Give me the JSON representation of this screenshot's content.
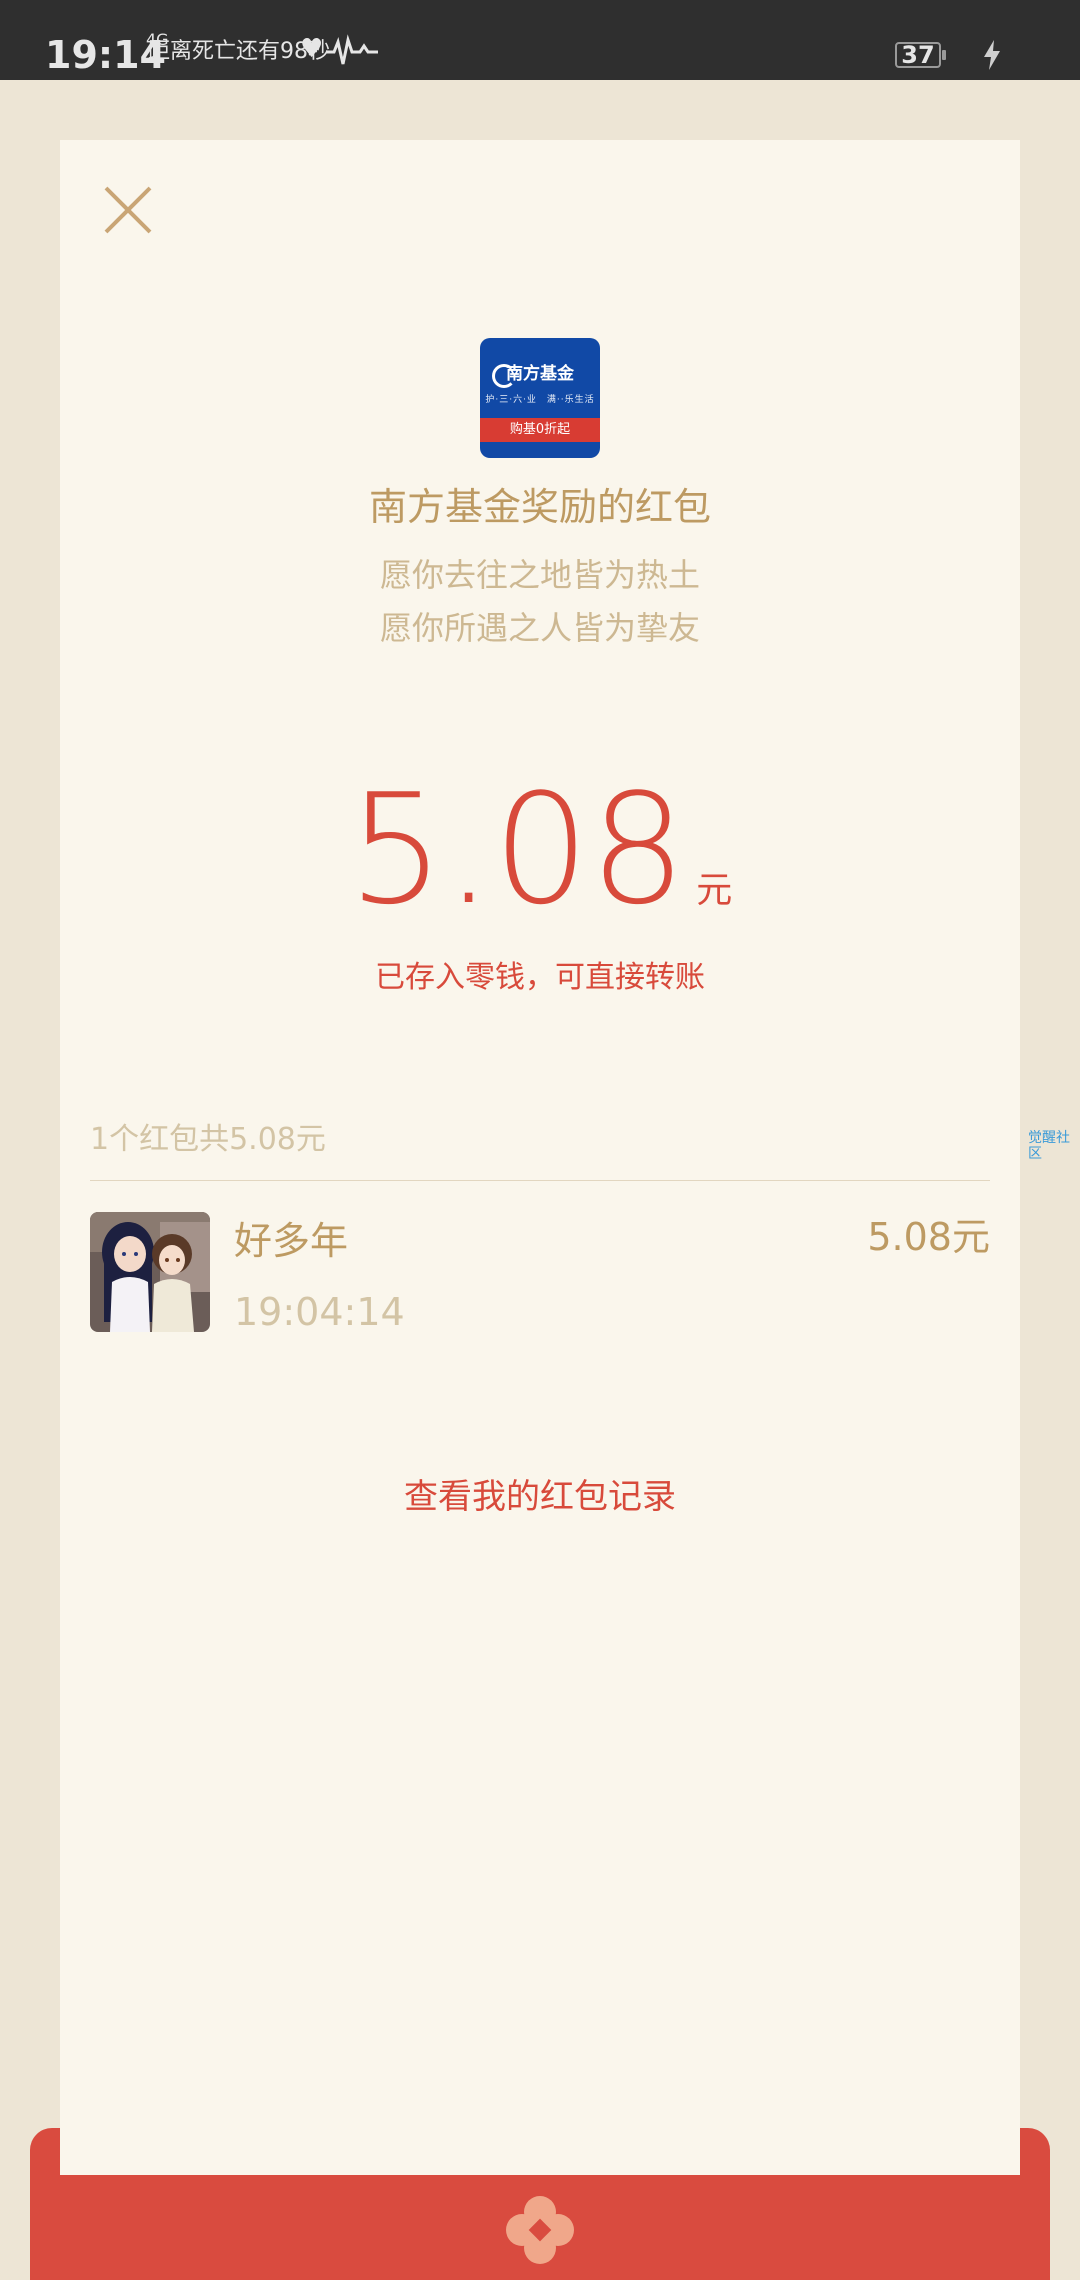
{
  "status_bar": {
    "time": "19:14",
    "network": "4G",
    "notification_text": "距离死亡还有98秒",
    "battery": "37"
  },
  "header": {
    "close_icon": "close-icon"
  },
  "logo": {
    "brand": "南方基金",
    "slogan": "护·三·六·业　满··乐生活",
    "ribbon": "购基0折起"
  },
  "envelope": {
    "sender": "南方基金奖励的红包",
    "wish_line1": "愿你去往之地皆为热土",
    "wish_line2": "愿你所遇之人皆为挚友",
    "amount": "5.08",
    "unit": "元",
    "saved_note": "已存入零钱，可直接转账"
  },
  "summary": "1个红包共5.08元",
  "recipients": [
    {
      "name": "好多年",
      "time": "19:04:14",
      "amount": "5.08元",
      "avatar_icon": "anime-avatar"
    }
  ],
  "record_link": "查看我的红包记录",
  "watermark": "觉醒社区",
  "colors": {
    "accent_red": "#d84a3b",
    "gold_text": "#bd9a62",
    "card_bg": "#faf6ec",
    "page_bg": "#ede5d5",
    "logo_blue": "#1149a6"
  }
}
